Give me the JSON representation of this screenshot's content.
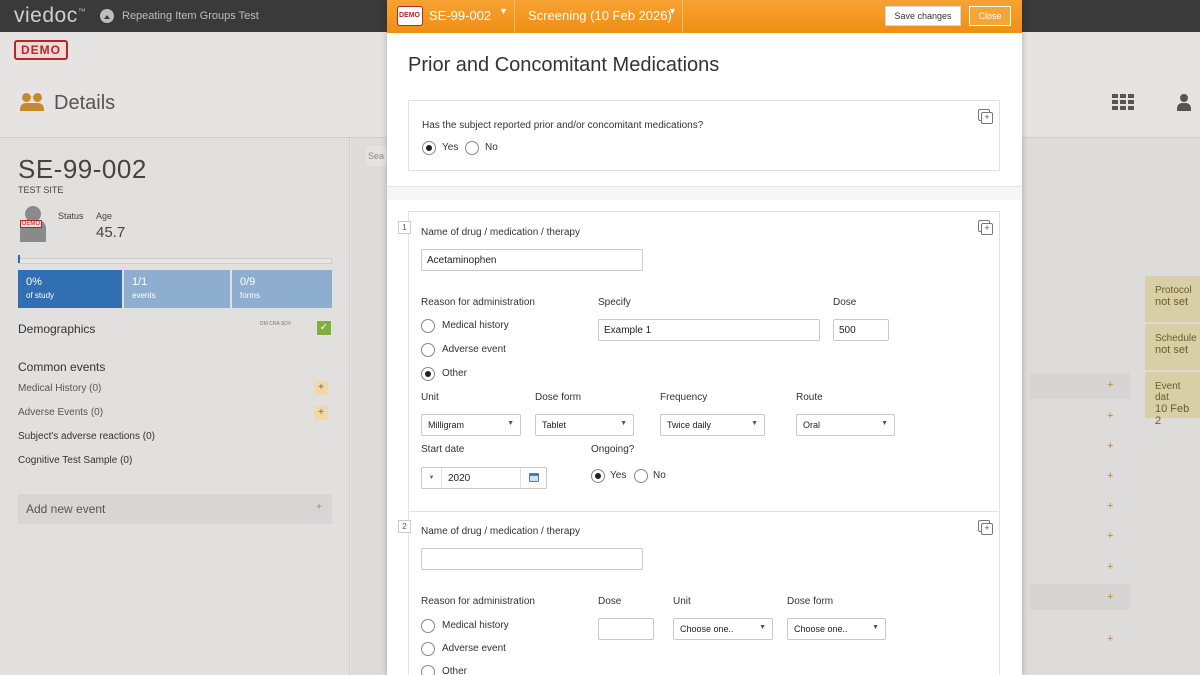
{
  "app": {
    "logo": "viedoc",
    "logo_mark": "™",
    "study_name": "Repeating Item Groups Test",
    "demo_badge": "DEMO"
  },
  "details": {
    "title": "Details",
    "subject_id": "SE-99-002",
    "site": "TEST SITE",
    "avatar_tag": "DEMO",
    "status_label": "Status",
    "age_label": "Age",
    "age_value": "45.7",
    "stats": [
      {
        "value": "0%",
        "label": "of study"
      },
      {
        "value": "1/1",
        "label": "events"
      },
      {
        "value": "0/9",
        "label": "forms"
      }
    ],
    "demographics": "Demographics",
    "demo_icons": "DM CRA SDV",
    "common_events_title": "Common events",
    "common_events": [
      {
        "label": "Medical History (0)"
      },
      {
        "label": "Adverse Events (0)"
      },
      {
        "label": "Subject's adverse reactions (0)"
      },
      {
        "label": "Cognitive Test Sample (0)"
      }
    ],
    "add_new_event": "Add new event",
    "plus": "+"
  },
  "background": {
    "search_stub": "Sea",
    "right_cards": [
      {
        "line1": "Protocol",
        "line2": "not set"
      },
      {
        "line1": "Schedule",
        "line2": "not set"
      },
      {
        "line1": "Event dat",
        "line2": "10 Feb 2"
      }
    ]
  },
  "modal": {
    "demo_icon": "DEMO",
    "subject": "SE-99-002",
    "event": "Screening (10 Feb 2026)",
    "save_button": "Save changes",
    "close_button": "Close",
    "form_title": "Prior and Concomitant Medications",
    "question1": "Has the subject reported prior and/or concomitant medications?",
    "q1_yes": "Yes",
    "q1_no": "No",
    "q1_selected": "Yes",
    "item1": {
      "index": "1",
      "name_label": "Name of drug / medication / therapy",
      "name_value": "Acetaminophen",
      "reason_label": "Reason for administration",
      "reason_options": [
        "Medical history",
        "Adverse event",
        "Other"
      ],
      "reason_selected": "Other",
      "specify_label": "Specify",
      "specify_value": "Example 1",
      "dose_label": "Dose",
      "dose_value": "500",
      "unit_label": "Unit",
      "unit_value": "Milligram",
      "dose_form_label": "Dose form",
      "dose_form_value": "Tablet",
      "frequency_label": "Frequency",
      "frequency_value": "Twice daily",
      "route_label": "Route",
      "route_value": "Oral",
      "start_date_label": "Start date",
      "start_date_value": "2020",
      "ongoing_label": "Ongoing?",
      "ongoing_yes": "Yes",
      "ongoing_no": "No",
      "ongoing_selected": "Yes"
    },
    "item2": {
      "index": "2",
      "name_label": "Name of drug / medication / therapy",
      "name_value": "",
      "reason_label": "Reason for administration",
      "reason_options": [
        "Medical history",
        "Adverse event",
        "Other"
      ],
      "dose_label": "Dose",
      "dose_value": "",
      "unit_label": "Unit",
      "unit_value": "Choose one..",
      "dose_form_label": "Dose form",
      "dose_form_value": "Choose one.."
    }
  }
}
